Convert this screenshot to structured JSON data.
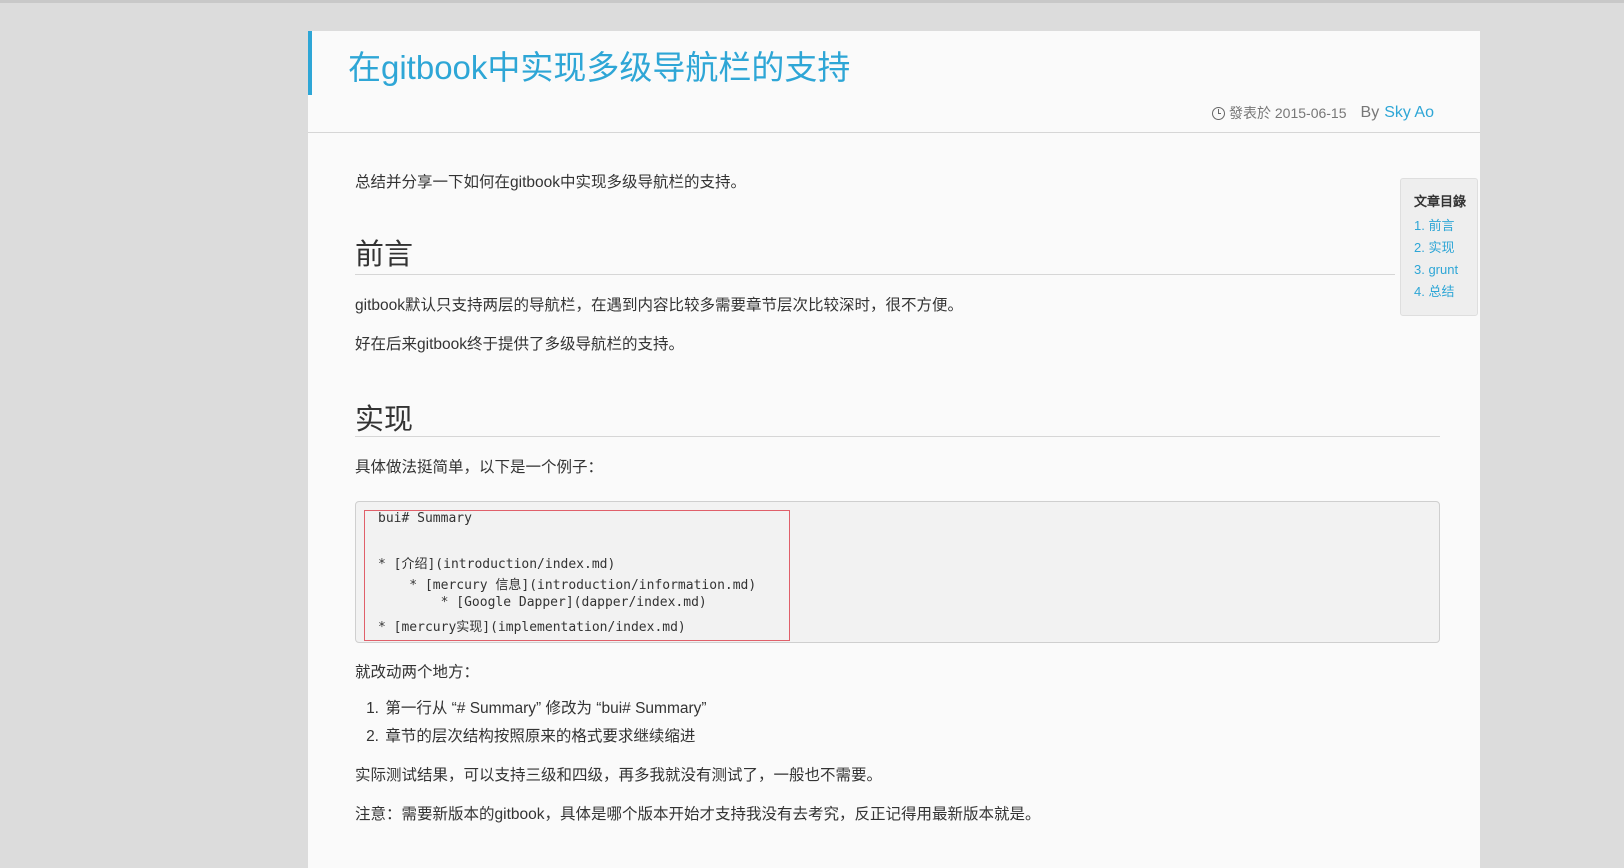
{
  "article": {
    "title": "在gitbook中实现多级导航栏的支持",
    "meta": {
      "published_label": "發表於 2015-06-15",
      "by_label": "By",
      "author": "Sky Ao"
    },
    "intro": "总结并分享一下如何在gitbook中实现多级导航栏的支持。",
    "toc": {
      "title": "文章目錄",
      "items": [
        "1. 前言",
        "2. 实现",
        "3. grunt",
        "4. 总结"
      ]
    },
    "section1": {
      "heading": "前言",
      "p1": "gitbook默认只支持两层的导航栏，在遇到内容比较多需要章节层次比较深时，很不方便。",
      "p2": "好在后来gitbook终于提供了多级导航栏的支持。"
    },
    "section2": {
      "heading": "实现",
      "p1": "具体做法挺简单，以下是一个例子：",
      "code_lines": [
        "bui# Summary",
        "",
        "* [介绍](introduction/index.md)",
        "    * [mercury 信息](introduction/information.md)",
        "        * [Google Dapper](dapper/index.md)",
        "* [mercury实现](implementation/index.md)"
      ],
      "p2": "就改动两个地方：",
      "list": [
        {
          "num": "1.",
          "text": "第一行从 “# Summary” 修改为 “bui# Summary”"
        },
        {
          "num": "2.",
          "text": "章节的层次结构按照原来的格式要求继续缩进"
        }
      ],
      "p3": "实际测试结果，可以支持三级和四级，再多我就没有测试了，一般也不需要。",
      "p4": "注意：需要新版本的gitbook，具体是哪个版本开始才支持我没有去考究，反正记得用最新版本就是。"
    }
  }
}
